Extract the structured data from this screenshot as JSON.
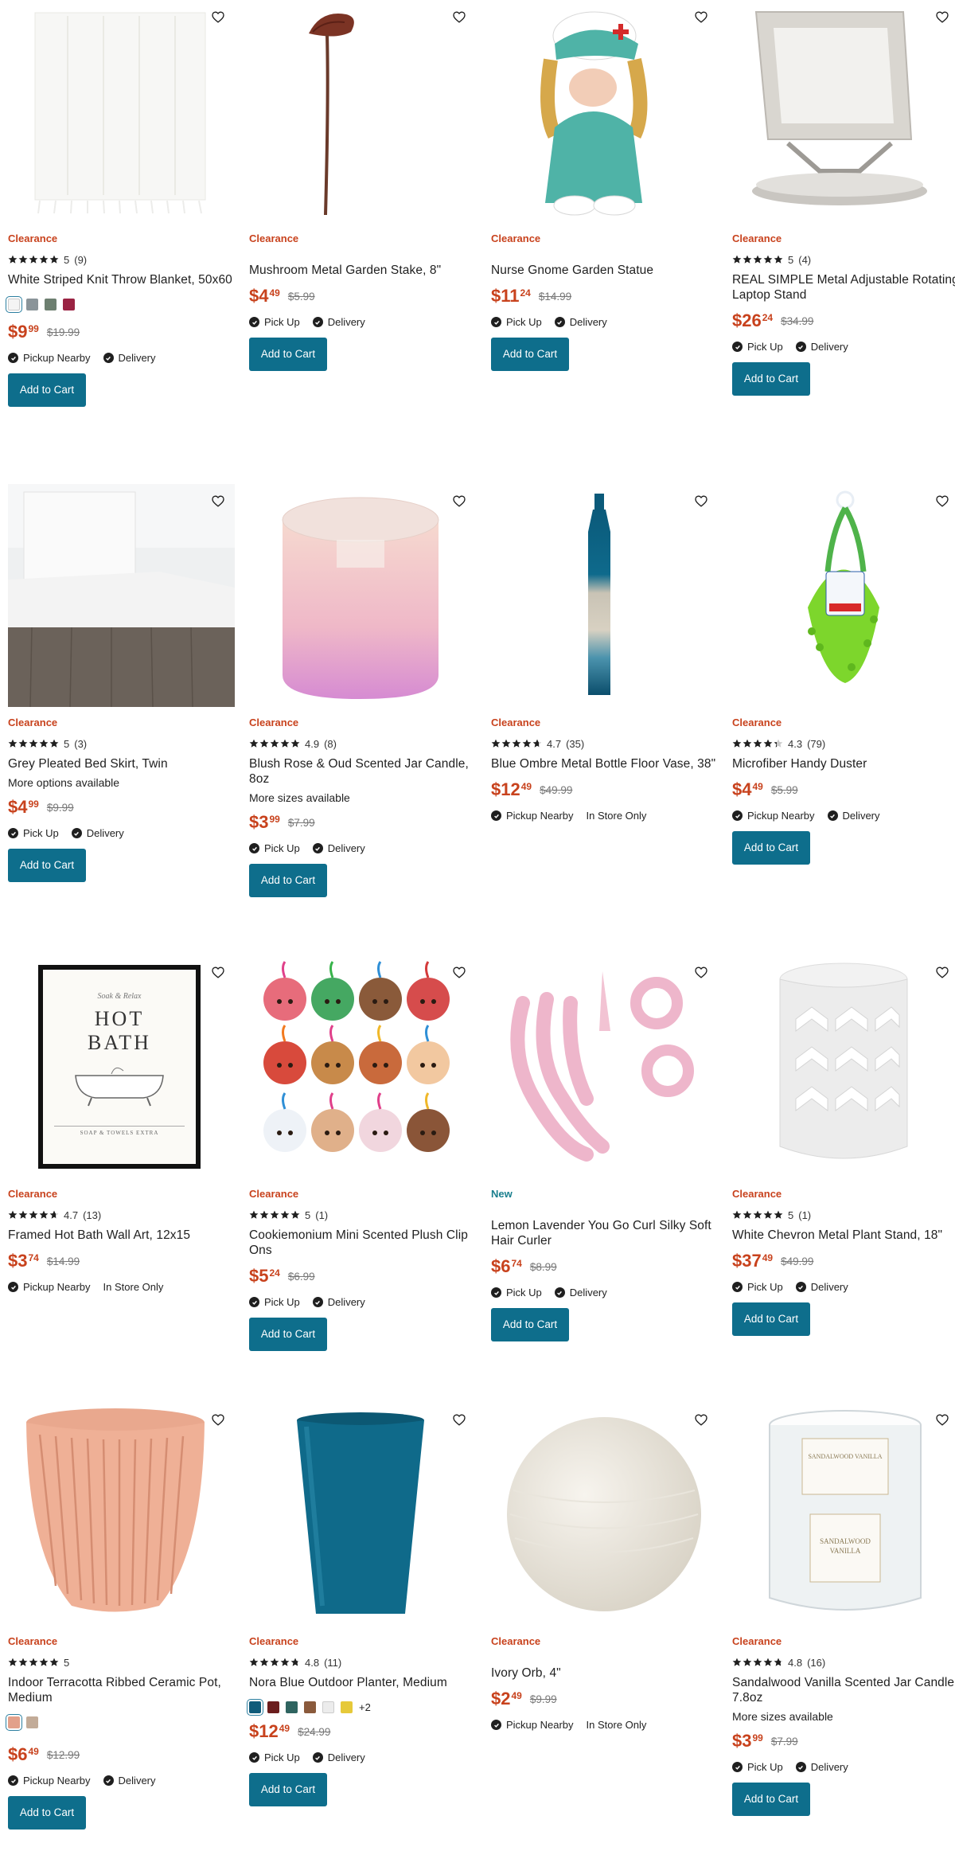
{
  "products": [
    {
      "badge": "Clearance",
      "rating": "5",
      "reviews": "(9)",
      "stars": 5,
      "title": "White Striped Knit Throw Blanket, 50x60",
      "price_dollars": "$9",
      "price_cents": "99",
      "was": "$19.99",
      "fulfil_a": "Pickup Nearby",
      "fulfil_b": "Delivery",
      "button": "Add to Cart",
      "swatches": [
        "#f4f4f4",
        "#8a9499",
        "#6d7f70",
        "#9a2343"
      ],
      "swatch_more": ""
    },
    {
      "badge": "Clearance",
      "title": "Mushroom Metal Garden Stake, 8\"",
      "price_dollars": "$4",
      "price_cents": "49",
      "was": "$5.99",
      "fulfil_a": "Pick Up",
      "fulfil_b": "Delivery",
      "button": "Add to Cart"
    },
    {
      "badge": "Clearance",
      "title": "Nurse Gnome Garden Statue",
      "price_dollars": "$11",
      "price_cents": "24",
      "was": "$14.99",
      "fulfil_a": "Pick Up",
      "fulfil_b": "Delivery",
      "button": "Add to Cart"
    },
    {
      "badge": "Clearance",
      "rating": "5",
      "reviews": "(4)",
      "stars": 5,
      "title": "REAL SIMPLE Metal Adjustable Rotating Laptop Stand",
      "price_dollars": "$26",
      "price_cents": "24",
      "was": "$34.99",
      "fulfil_a": "Pick Up",
      "fulfil_b": "Delivery",
      "button": "Add to Cart"
    },
    {
      "badge": "Clearance",
      "rating": "5",
      "reviews": "(3)",
      "stars": 5,
      "title": "Grey Pleated Bed Skirt, Twin",
      "note": "More options available",
      "price_dollars": "$4",
      "price_cents": "99",
      "was": "$9.99",
      "fulfil_a": "Pick Up",
      "fulfil_b": "Delivery",
      "button": "Add to Cart"
    },
    {
      "badge": "Clearance",
      "rating": "4.9",
      "reviews": "(8)",
      "stars": 5,
      "title": "Blush Rose & Oud Scented Jar Candle, 8oz",
      "note": "More sizes available",
      "price_dollars": "$3",
      "price_cents": "99",
      "was": "$7.99",
      "fulfil_a": "Pick Up",
      "fulfil_b": "Delivery",
      "button": "Add to Cart"
    },
    {
      "badge": "Clearance",
      "rating": "4.7",
      "reviews": "(35)",
      "stars": 4.7,
      "title": "Blue Ombre Metal Bottle Floor Vase, 38\"",
      "price_dollars": "$12",
      "price_cents": "49",
      "was": "$49.99",
      "fulfil_a": "Pickup Nearby",
      "fulfil_b": "In Store Only",
      "fulfil_b_nocheck": true
    },
    {
      "badge": "Clearance",
      "rating": "4.3",
      "reviews": "(79)",
      "stars": 4.3,
      "title": "Microfiber Handy Duster",
      "price_dollars": "$4",
      "price_cents": "49",
      "was": "$5.99",
      "fulfil_a": "Pickup Nearby",
      "fulfil_b": "Delivery",
      "button": "Add to Cart"
    },
    {
      "badge": "Clearance",
      "rating": "4.7",
      "reviews": "(13)",
      "stars": 4.7,
      "title": "Framed Hot Bath Wall Art, 12x15",
      "price_dollars": "$3",
      "price_cents": "74",
      "was": "$14.99",
      "fulfil_a": "Pickup Nearby",
      "fulfil_b": "In Store Only",
      "fulfil_b_nocheck": true,
      "art_line1": "Soak & Relax",
      "art_line2": "HOT",
      "art_line3": "BATH",
      "art_line4": "SOAP & TOWELS EXTRA"
    },
    {
      "badge": "Clearance",
      "rating": "5",
      "reviews": "(1)",
      "stars": 5,
      "title": "Cookiemonium Mini Scented Plush Clip Ons",
      "price_dollars": "$5",
      "price_cents": "24",
      "was": "$6.99",
      "fulfil_a": "Pick Up",
      "fulfil_b": "Delivery",
      "button": "Add to Cart"
    },
    {
      "badge": "New",
      "badge_new": true,
      "title": "Lemon Lavender You Go Curl Silky Soft Hair Curler",
      "price_dollars": "$6",
      "price_cents": "74",
      "was": "$8.99",
      "fulfil_a": "Pick Up",
      "fulfil_b": "Delivery",
      "button": "Add to Cart"
    },
    {
      "badge": "Clearance",
      "rating": "5",
      "reviews": "(1)",
      "stars": 5,
      "title": "White Chevron Metal Plant Stand, 18\"",
      "price_dollars": "$37",
      "price_cents": "49",
      "was": "$49.99",
      "fulfil_a": "Pick Up",
      "fulfil_b": "Delivery",
      "button": "Add to Cart"
    },
    {
      "badge": "Clearance",
      "rating": "5",
      "reviews": "",
      "stars": 5,
      "title": "Indoor Terracotta Ribbed Ceramic Pot, Medium",
      "price_dollars": "$6",
      "price_cents": "49",
      "was": "$12.99",
      "fulfil_a": "Pickup Nearby",
      "fulfil_b": "Delivery",
      "button": "Add to Cart",
      "swatches": [
        "#e2a08a",
        "#c2ab98"
      ],
      "swatch_more": ""
    },
    {
      "badge": "Clearance",
      "rating": "4.8",
      "reviews": "(11)",
      "stars": 4.8,
      "title": "Nora Blue Outdoor Planter, Medium",
      "price_dollars": "$12",
      "price_cents": "49",
      "was": "$24.99",
      "fulfil_a": "Pick Up",
      "fulfil_b": "Delivery",
      "button": "Add to Cart",
      "swatches": [
        "#0f5b7a",
        "#6b1d1d",
        "#2f6460",
        "#8a5a3c",
        "#ececec",
        "#e6c93a"
      ],
      "swatch_more": "+2"
    },
    {
      "badge": "Clearance",
      "title": "Ivory Orb, 4\"",
      "price_dollars": "$2",
      "price_cents": "49",
      "was": "$9.99",
      "fulfil_a": "Pickup Nearby",
      "fulfil_b": "In Store Only",
      "fulfil_b_nocheck": true
    },
    {
      "badge": "Clearance",
      "rating": "4.8",
      "reviews": "(16)",
      "stars": 4.8,
      "title": "Sandalwood Vanilla Scented Jar Candle, 7.8oz",
      "note": "More sizes available",
      "price_dollars": "$3",
      "price_cents": "99",
      "was": "$7.99",
      "fulfil_a": "Pick Up",
      "fulfil_b": "Delivery",
      "button": "Add to Cart",
      "label_text1": "SANDALWOOD VANILLA",
      "label_text2": "SANDALWOOD VANILLA"
    }
  ],
  "colors": {
    "accent": "#c8421d",
    "button": "#0e6e8c",
    "new_badge": "#1a7f8e"
  }
}
